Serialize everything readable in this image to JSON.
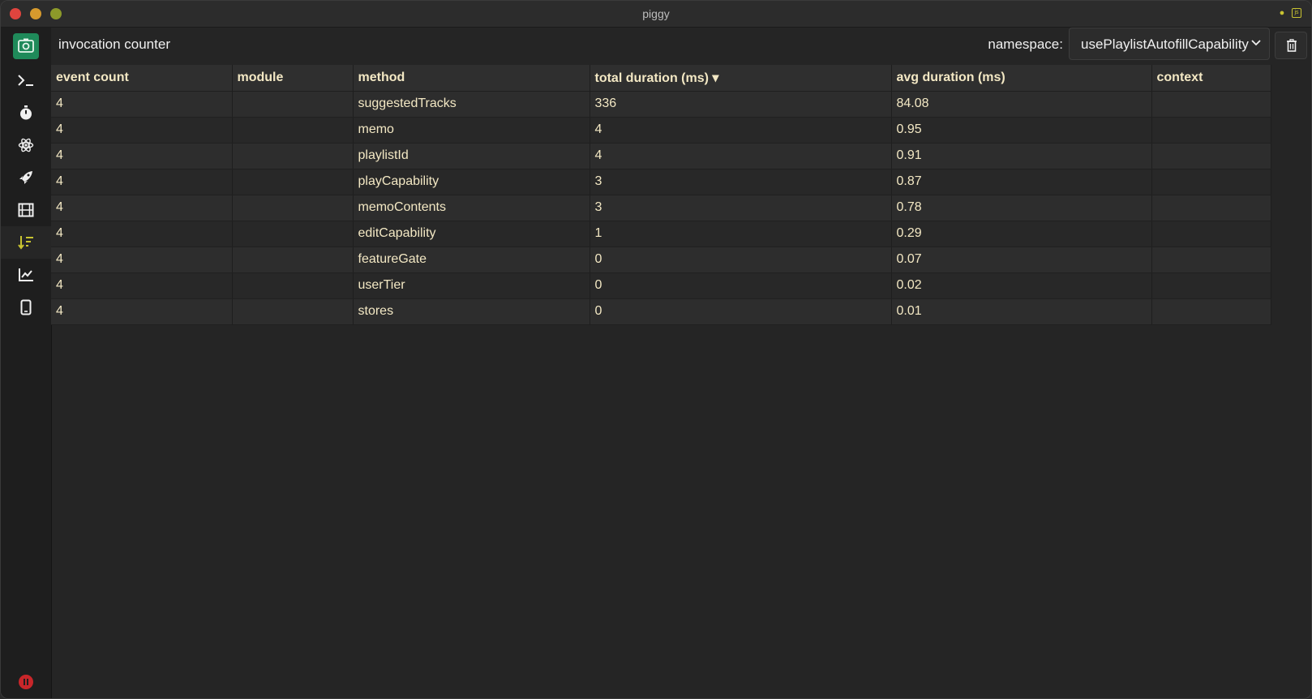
{
  "window": {
    "title": "piggy"
  },
  "sidebar": {
    "items": [
      {
        "icon": "terminal-icon"
      },
      {
        "icon": "stopwatch-icon"
      },
      {
        "icon": "react-atom-icon"
      },
      {
        "icon": "rocket-icon"
      },
      {
        "icon": "film-icon"
      },
      {
        "icon": "sort-descending-icon",
        "active": true
      },
      {
        "icon": "line-chart-icon"
      },
      {
        "icon": "mobile-device-icon"
      }
    ],
    "record_state": "pause"
  },
  "header": {
    "title": "invocation counter",
    "namespace_label": "namespace:",
    "namespace_value": "usePlaylistAutofillCapability"
  },
  "table": {
    "columns": [
      "event count",
      "module",
      "method",
      "total duration (ms) ▾",
      "avg duration (ms)",
      "context"
    ],
    "rows": [
      [
        "4",
        "",
        "suggestedTracks",
        "336",
        "84.08",
        ""
      ],
      [
        "4",
        "",
        "memo",
        "4",
        "0.95",
        ""
      ],
      [
        "4",
        "",
        "playlistId",
        "4",
        "0.91",
        ""
      ],
      [
        "4",
        "",
        "playCapability",
        "3",
        "0.87",
        ""
      ],
      [
        "4",
        "",
        "memoContents",
        "3",
        "0.78",
        ""
      ],
      [
        "4",
        "",
        "editCapability",
        "1",
        "0.29",
        ""
      ],
      [
        "4",
        "",
        "featureGate",
        "0",
        "0.07",
        ""
      ],
      [
        "4",
        "",
        "userTier",
        "0",
        "0.02",
        ""
      ],
      [
        "4",
        "",
        "stores",
        "0",
        "0.01",
        ""
      ]
    ]
  },
  "colors": {
    "accent": "#c9c431",
    "text": "#f3e8c4",
    "logo": "#1f8a5a"
  }
}
